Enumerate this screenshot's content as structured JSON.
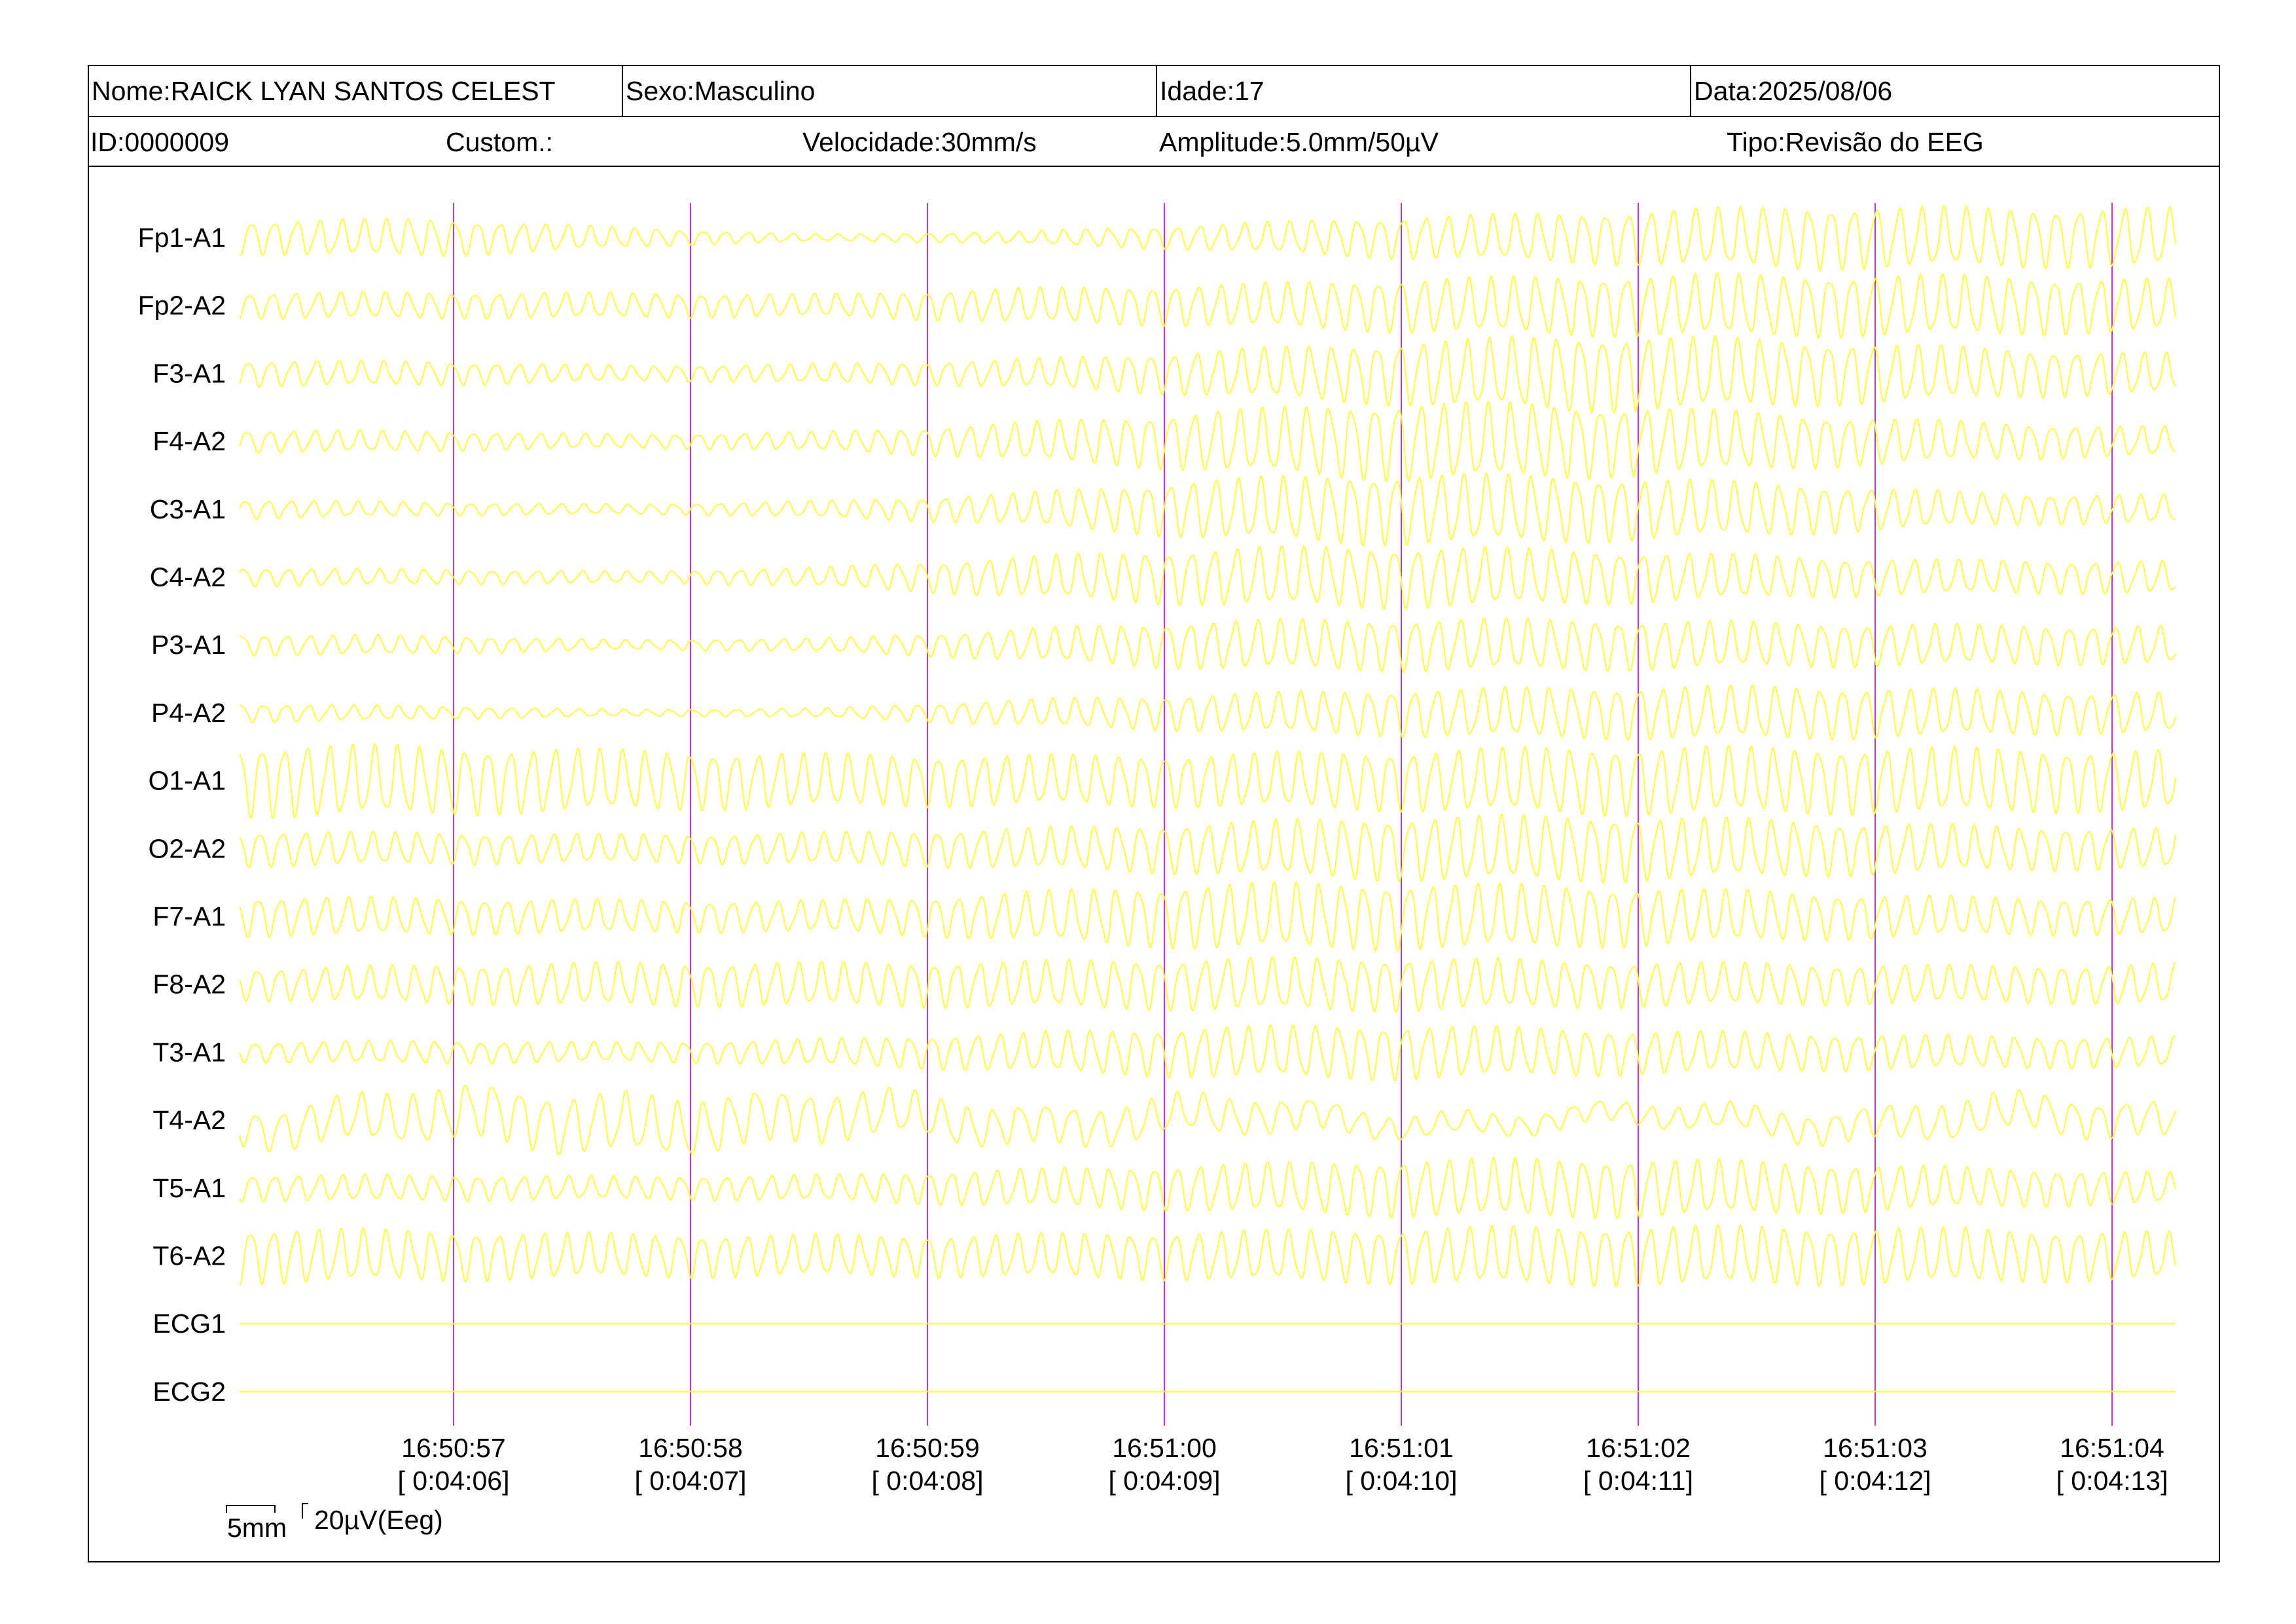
{
  "header": {
    "name": "Nome:RAICK LYAN SANTOS CELEST",
    "sex": "Sexo:Masculino",
    "age": "Idade:17",
    "date": "Data:2025/08/06",
    "id": "ID:0000009",
    "custom": "Custom.:",
    "speed": "Velocidade:30mm/s",
    "amplitude": "Amplitude:5.0mm/50µV",
    "type": "Tipo:Revisão do EEG"
  },
  "scale": {
    "time_label": "5mm",
    "amp_label": "20µV(Eeg)"
  },
  "colors": {
    "trace": "#ffff33",
    "marker": "#cc33cc",
    "text": "#000000",
    "border": "#000000",
    "background": "#ffffff"
  },
  "chart_data": {
    "type": "line",
    "title": "",
    "xlabel": "",
    "ylabel": "",
    "xlim": [
      "16:50:56.1",
      "16:51:04.3"
    ],
    "grid": false,
    "legend": "none",
    "time_markers": [
      {
        "clock": "16:50:57",
        "elapsed": "[ 0:04:06]"
      },
      {
        "clock": "16:50:58",
        "elapsed": "[ 0:04:07]"
      },
      {
        "clock": "16:50:59",
        "elapsed": "[ 0:04:08]"
      },
      {
        "clock": "16:51:00",
        "elapsed": "[ 0:04:09]"
      },
      {
        "clock": "16:51:01",
        "elapsed": "[ 0:04:10]"
      },
      {
        "clock": "16:51:02",
        "elapsed": "[ 0:04:11]"
      },
      {
        "clock": "16:51:03",
        "elapsed": "[ 0:04:12]"
      },
      {
        "clock": "16:51:04",
        "elapsed": "[ 0:04:13]"
      }
    ],
    "channels": [
      {
        "name": "Fp1-A1",
        "freq_hz": 10.5,
        "amp_uv": [
          12,
          12,
          6,
          2,
          4,
          10,
          18,
          22,
          24,
          20,
          18
        ]
      },
      {
        "name": "Fp2-A2",
        "freq_hz": 10.5,
        "amp_uv": [
          8,
          8,
          8,
          8,
          14,
          18,
          22,
          22,
          20,
          18,
          16
        ]
      },
      {
        "name": "F3-A1",
        "freq_hz": 10.5,
        "amp_uv": [
          8,
          8,
          6,
          8,
          12,
          18,
          22,
          24,
          20,
          16,
          14
        ]
      },
      {
        "name": "F4-A2",
        "freq_hz": 10.5,
        "amp_uv": [
          8,
          8,
          6,
          8,
          14,
          20,
          24,
          22,
          18,
          14,
          12
        ]
      },
      {
        "name": "C3-A1",
        "freq_hz": 10.5,
        "amp_uv": [
          8,
          6,
          4,
          6,
          10,
          18,
          22,
          22,
          20,
          14,
          12
        ]
      },
      {
        "name": "C4-A2",
        "freq_hz": 10.5,
        "amp_uv": [
          8,
          6,
          4,
          6,
          12,
          18,
          22,
          22,
          18,
          14,
          12
        ]
      },
      {
        "name": "P3-A1",
        "freq_hz": 10.5,
        "amp_uv": [
          8,
          6,
          3,
          4,
          10,
          18,
          22,
          22,
          18,
          14,
          12
        ]
      },
      {
        "name": "P4-A2",
        "freq_hz": 10.5,
        "amp_uv": [
          6,
          4,
          2,
          3,
          10,
          16,
          20,
          20,
          18,
          14,
          12
        ]
      },
      {
        "name": "O1-A1",
        "freq_hz": 10.5,
        "amp_uv": [
          22,
          22,
          22,
          22,
          22,
          22,
          22,
          22,
          20,
          20,
          20
        ]
      },
      {
        "name": "O2-A2",
        "freq_hz": 10.5,
        "amp_uv": [
          12,
          12,
          12,
          14,
          16,
          18,
          20,
          20,
          18,
          16,
          16
        ]
      },
      {
        "name": "F7-A1",
        "freq_hz": 10.5,
        "amp_uv": [
          16,
          16,
          14,
          12,
          16,
          20,
          20,
          20,
          18,
          16,
          16
        ]
      },
      {
        "name": "F8-A2",
        "freq_hz": 10.5,
        "amp_uv": [
          14,
          16,
          16,
          14,
          14,
          16,
          18,
          18,
          18,
          16,
          16
        ]
      },
      {
        "name": "T3-A1",
        "freq_hz": 10.5,
        "amp_uv": [
          8,
          8,
          6,
          8,
          12,
          18,
          22,
          20,
          16,
          12,
          10
        ]
      },
      {
        "name": "T4-A2",
        "freq_hz": 9.0,
        "amp_uv": [
          12,
          16,
          18,
          16,
          14,
          16,
          10,
          8,
          10,
          12,
          10
        ]
      },
      {
        "name": "T5-A1",
        "freq_hz": 10.5,
        "amp_uv": [
          8,
          8,
          8,
          10,
          16,
          20,
          22,
          20,
          16,
          12,
          10
        ]
      },
      {
        "name": "T6-A2",
        "freq_hz": 10.5,
        "amp_uv": [
          18,
          18,
          18,
          18,
          18,
          18,
          18,
          18,
          18,
          18,
          18
        ]
      },
      {
        "name": "ECG1",
        "freq_hz": 0,
        "amp_uv": [
          0,
          0,
          0,
          0,
          0,
          0,
          0,
          0,
          0,
          0,
          0
        ]
      },
      {
        "name": "ECG2",
        "freq_hz": 0,
        "amp_uv": [
          0,
          0,
          0,
          0,
          0,
          0,
          0,
          0,
          0,
          0,
          0
        ]
      }
    ]
  }
}
